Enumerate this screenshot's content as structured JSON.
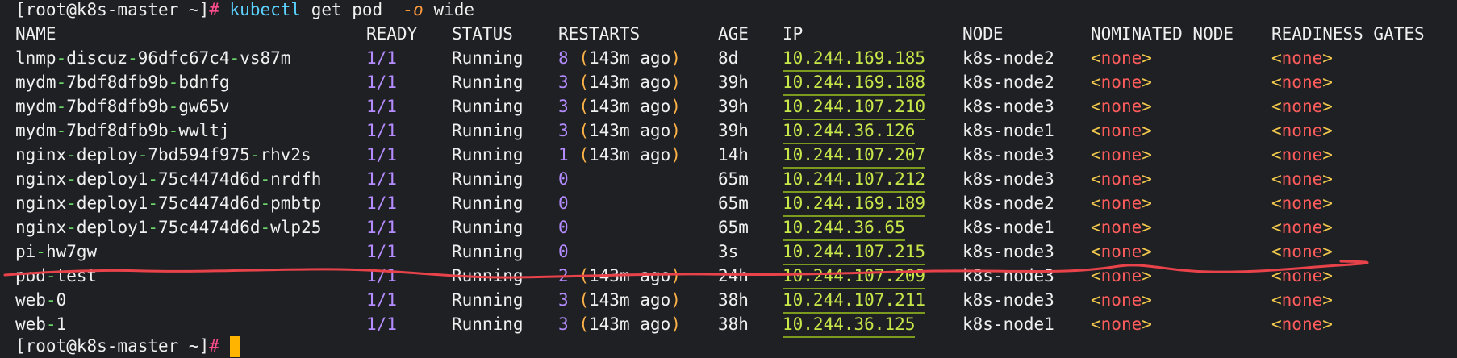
{
  "prompt": {
    "user_host": "[root@k8s-master ~]",
    "hash": "#",
    "command": "kubectl",
    "args1": "get pod ",
    "flag": "-o",
    "args2": "wide"
  },
  "headers": {
    "name": "NAME",
    "ready": "READY",
    "status": "STATUS",
    "restarts": "RESTARTS",
    "age": "AGE",
    "ip": "IP",
    "node": "NODE",
    "nominated": "NOMINATED NODE",
    "gates": "READINESS GATES"
  },
  "none_value": {
    "open": "<",
    "text": "none",
    "close": ">"
  },
  "pods": [
    {
      "name_a": "lnmp",
      "name_sep": "-",
      "name_b": "discuz",
      "name_sep2": "-",
      "name_c": "96dfc67c4",
      "name_sep3": "-",
      "name_d": "vs87m",
      "ready": "1/1",
      "status": "Running",
      "restarts": "8",
      "restart_ago": "(143m ago)",
      "age": "8d",
      "ip": "10.244.169.185",
      "node": "k8s-node2"
    },
    {
      "name_a": "mydm",
      "name_sep": "-",
      "name_b": "7bdf8dfb9b",
      "name_sep2": "-",
      "name_c": "bdnfg",
      "name_sep3": "",
      "name_d": "",
      "ready": "1/1",
      "status": "Running",
      "restarts": "3",
      "restart_ago": "(143m ago)",
      "age": "39h",
      "ip": "10.244.169.188",
      "node": "k8s-node2"
    },
    {
      "name_a": "mydm",
      "name_sep": "-",
      "name_b": "7bdf8dfb9b",
      "name_sep2": "-",
      "name_c": "gw65v",
      "name_sep3": "",
      "name_d": "",
      "ready": "1/1",
      "status": "Running",
      "restarts": "3",
      "restart_ago": "(143m ago)",
      "age": "39h",
      "ip": "10.244.107.210",
      "node": "k8s-node3"
    },
    {
      "name_a": "mydm",
      "name_sep": "-",
      "name_b": "7bdf8dfb9b",
      "name_sep2": "-",
      "name_c": "wwltj",
      "name_sep3": "",
      "name_d": "",
      "ready": "1/1",
      "status": "Running",
      "restarts": "3",
      "restart_ago": "(143m ago)",
      "age": "39h",
      "ip": "10.244.36.126",
      "node": "k8s-node1"
    },
    {
      "name_a": "nginx",
      "name_sep": "-",
      "name_b": "deploy",
      "name_sep2": "-",
      "name_c": "7bd594f975",
      "name_sep3": "-",
      "name_d": "rhv2s",
      "ready": "1/1",
      "status": "Running",
      "restarts": "1",
      "restart_ago": "(143m ago)",
      "age": "14h",
      "ip": "10.244.107.207",
      "node": "k8s-node3"
    },
    {
      "name_a": "nginx",
      "name_sep": "-",
      "name_b": "deploy1",
      "name_sep2": "-",
      "name_c": "75c4474d6d",
      "name_sep3": "-",
      "name_d": "nrdfh",
      "ready": "1/1",
      "status": "Running",
      "restarts": "0",
      "restart_ago": "",
      "age": "65m",
      "ip": "10.244.107.212",
      "node": "k8s-node3"
    },
    {
      "name_a": "nginx",
      "name_sep": "-",
      "name_b": "deploy1",
      "name_sep2": "-",
      "name_c": "75c4474d6d",
      "name_sep3": "-",
      "name_d": "pmbtp",
      "ready": "1/1",
      "status": "Running",
      "restarts": "0",
      "restart_ago": "",
      "age": "65m",
      "ip": "10.244.169.189",
      "node": "k8s-node2"
    },
    {
      "name_a": "nginx",
      "name_sep": "-",
      "name_b": "deploy1",
      "name_sep2": "-",
      "name_c": "75c4474d6d",
      "name_sep3": "-",
      "name_d": "wlp25",
      "ready": "1/1",
      "status": "Running",
      "restarts": "0",
      "restart_ago": "",
      "age": "65m",
      "ip": "10.244.36.65",
      "node": "k8s-node1"
    },
    {
      "name_a": "pi",
      "name_sep": "-",
      "name_b": "hw7gw",
      "name_sep2": "",
      "name_c": "",
      "name_sep3": "",
      "name_d": "",
      "ready": "1/1",
      "status": "Running",
      "restarts": "0",
      "restart_ago": "",
      "age": "3s",
      "ip": "10.244.107.215",
      "node": "k8s-node3"
    },
    {
      "name_a": "pod",
      "name_sep": "-",
      "name_b": "test",
      "name_sep2": "",
      "name_c": "",
      "name_sep3": "",
      "name_d": "",
      "ready": "1/1",
      "status": "Running",
      "restarts": "2",
      "restart_ago": "(143m ago)",
      "age": "24h",
      "ip": "10.244.107.209",
      "node": "k8s-node3"
    },
    {
      "name_a": "web",
      "name_sep": "-",
      "name_b": "0",
      "name_sep2": "",
      "name_c": "",
      "name_sep3": "",
      "name_d": "",
      "ready": "1/1",
      "status": "Running",
      "restarts": "3",
      "restart_ago": "(143m ago)",
      "age": "38h",
      "ip": "10.244.107.211",
      "node": "k8s-node3"
    },
    {
      "name_a": "web",
      "name_sep": "-",
      "name_b": "1",
      "name_sep2": "",
      "name_c": "",
      "name_sep3": "",
      "name_d": "",
      "ready": "1/1",
      "status": "Running",
      "restarts": "3",
      "restart_ago": "(143m ago)",
      "age": "38h",
      "ip": "10.244.36.125",
      "node": "k8s-node1"
    }
  ],
  "final_prompt": {
    "user_host": "[root@k8s-master ~]",
    "hash": "#"
  },
  "colors": {
    "background": "#1f2024",
    "strike_line": "#e8434a",
    "cursor": "#ffb400"
  }
}
